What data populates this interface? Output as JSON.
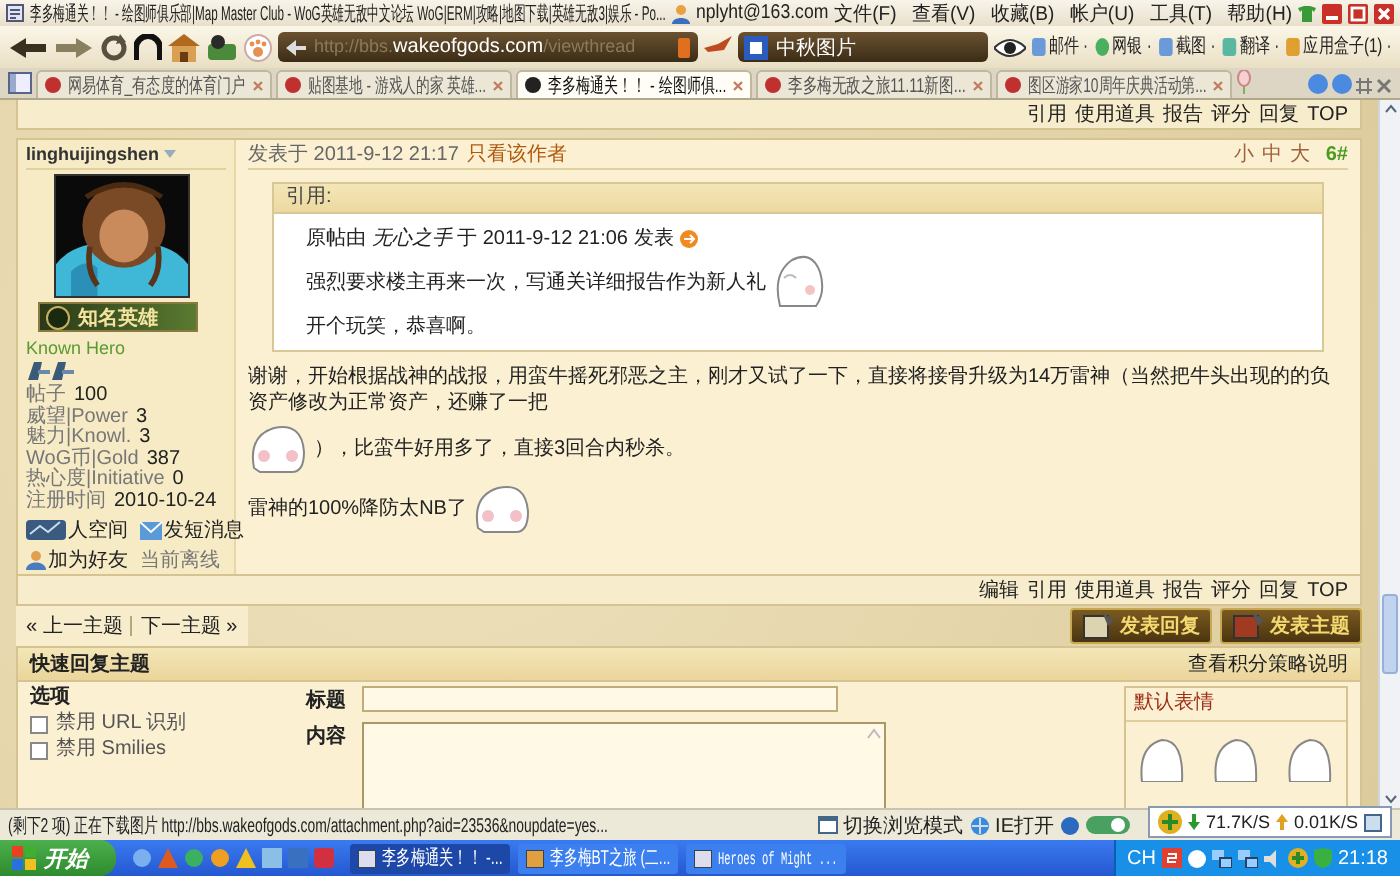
{
  "window": {
    "title": "李多梅通关！！ - 绘图师俱乐部|Map Master Club - WoG英雄无敌中文论坛 WoG|ERM|攻略|地图下载|英雄无敌3|娱乐 - Po...",
    "account": "nplyht@163.com",
    "menu": [
      "文件(F)",
      "查看(V)",
      "收藏(B)",
      "帐户(U)",
      "工具(T)",
      "帮助(H)"
    ]
  },
  "toolbar": {
    "address": "http://bbs.**wakeofgods.com**/viewthread",
    "search": "中秋图片",
    "tools": [
      "邮件 ·",
      "网银 ·",
      "截图 ·",
      "翻译 ·",
      "应用盒子(1) ·"
    ]
  },
  "tabs": [
    {
      "label": "网易体育_有态度的体育门户",
      "selected": false
    },
    {
      "label": "贴图基地 - 游戏人的家 英雄...",
      "selected": false
    },
    {
      "label": "李多梅通关！！ - 绘图师俱...",
      "selected": true
    },
    {
      "label": "李多梅无敌之旅11.11新图...",
      "selected": false
    },
    {
      "label": "图区游家10周年庆典活动第...",
      "selected": false
    }
  ],
  "thread": {
    "top_actions": [
      "引用",
      "使用道具",
      "报告",
      "评分",
      "回复",
      "TOP"
    ],
    "post": {
      "author": "linghuijingshen",
      "badge": "知名英雄",
      "rank": "Known Hero",
      "stats": [
        {
          "label": "帖子",
          "value": "100"
        },
        {
          "label": "威望|Power",
          "value": "3"
        },
        {
          "label": "魅力|Knowl.",
          "value": "3"
        },
        {
          "label": "WoG币|Gold",
          "value": "387"
        },
        {
          "label": "热心度|Initiative",
          "value": "0"
        },
        {
          "label": "注册时间",
          "value": "2010-10-24"
        }
      ],
      "links": [
        "人空间",
        "发短消息",
        "加为好友",
        "当前离线"
      ],
      "posted": "发表于 2011-9-12 21:17",
      "author_only": "只看该作者",
      "font_sizes": [
        "小",
        "中",
        "大"
      ],
      "floor": "6#",
      "quote": {
        "title": "引用:",
        "source": "原帖由 *无心之手* 于 2011-9-12 21:06 发表",
        "lines": [
          [
            {
              "kind": "text",
              "text": "强烈要求楼主再来一次，写通关详细报告作为新人礼"
            },
            {
              "kind": "emoticon"
            }
          ],
          [
            {
              "kind": "text",
              "text": "开个玩笑，恭喜啊。"
            }
          ]
        ]
      },
      "body": [
        [
          {
            "kind": "text",
            "text": "谢谢，开始根据战神的战报，用蛮牛摇死邪恶之主，刚才又试了一下，直接将接骨升级为14万雷神（当然把牛头出现的的负资产修改为正常资产，还赚了一把"
          }
        ],
        [
          {
            "kind": "emoticon"
          },
          {
            "kind": "text",
            "text": "），比蛮牛好用多了，直接3回合内秒杀。"
          }
        ],
        [
          {
            "kind": "text",
            "text": "雷神的100%降防太NB了"
          },
          {
            "kind": "emoticon"
          }
        ]
      ]
    },
    "post_actions": [
      "编辑",
      "引用",
      "使用道具",
      "报告",
      "评分",
      "回复",
      "TOP"
    ],
    "prev_topic": "« 上一主题",
    "next_topic": "下一主题 »",
    "reply_buttons": [
      "发表回复",
      "发表主题"
    ]
  },
  "quick_reply": {
    "title": "快速回复主题",
    "help_link": "查看积分策略说明",
    "options_label": "选项",
    "options": [
      {
        "label": "禁用 URL 识别",
        "checked": false
      },
      {
        "label": "禁用 Smilies",
        "checked": false
      }
    ],
    "subject_label": "标题",
    "content_label": "内容",
    "smilies_title": "默认表情"
  },
  "status_bar": {
    "text": "(剩下2 项) 正在下载图片 http://bbs.wakeofgods.com/attachment.php?aid=23536&noupdate=yes...",
    "items": [
      "切换浏览模式",
      "IE打开"
    ],
    "download": "71.7K/S",
    "upload": "0.01K/S"
  },
  "taskbar": {
    "start": "开始",
    "tasks": [
      {
        "label": "李多梅通关！！ -...",
        "selected": true
      },
      {
        "label": "李多梅BT之旅 (二...",
        "selected": false
      },
      {
        "label": "Heroes of Might ...",
        "selected": false
      }
    ],
    "lang": "CH",
    "clock": "21:18"
  }
}
